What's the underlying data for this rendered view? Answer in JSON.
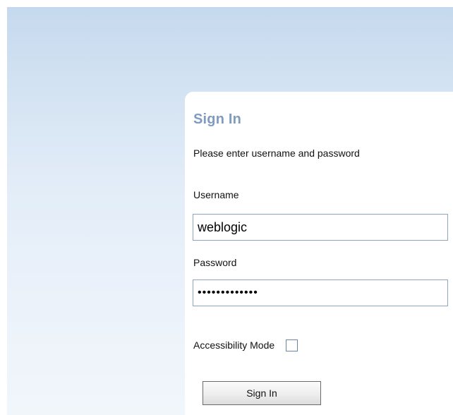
{
  "login": {
    "title": "Sign In",
    "subtitle": "Please enter username and password",
    "username_label": "Username",
    "username_value": "weblogic",
    "password_label": "Password",
    "password_value": "•••••••••••••",
    "accessibility_label": "Accessibility Mode",
    "accessibility_checked": false,
    "signin_button_label": "Sign In"
  },
  "colors": {
    "title": "#7f9bbf",
    "backdrop_top": "#c5d9ee",
    "backdrop_bottom": "#f1f6fb",
    "input_border": "#8ea5c1"
  }
}
